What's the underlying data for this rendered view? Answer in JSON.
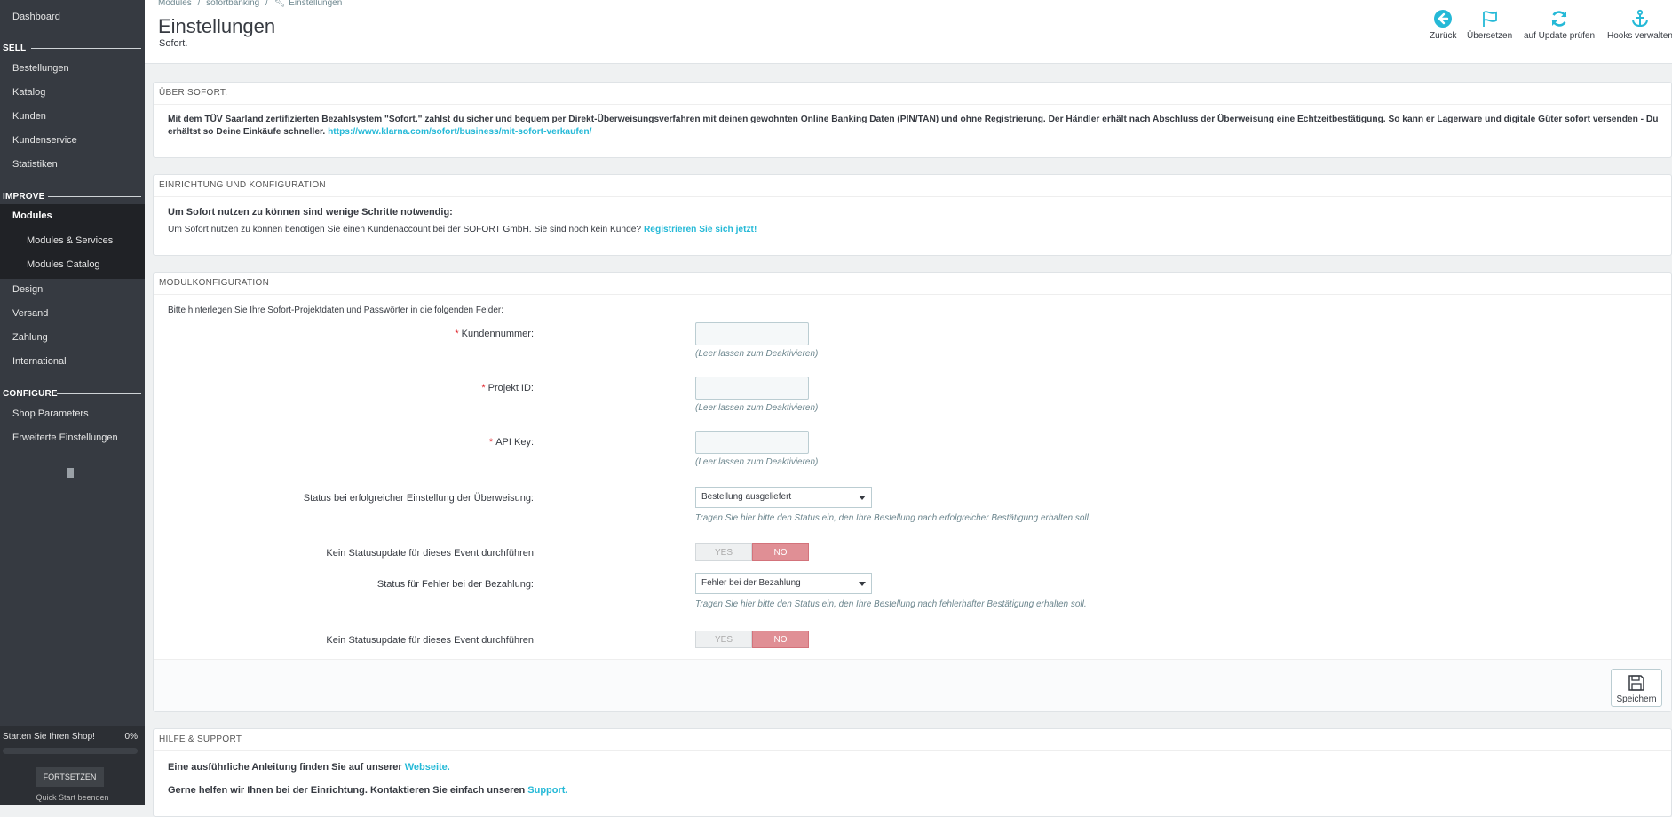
{
  "sidebar": {
    "dashboard": "Dashboard",
    "sections": {
      "sell": "SELL",
      "improve": "IMPROVE",
      "configure": "CONFIGURE"
    },
    "sell_items": [
      "Bestellungen",
      "Katalog",
      "Kunden",
      "Kundenservice",
      "Statistiken"
    ],
    "improve_items": {
      "modules": "Modules",
      "modules_services": "Modules & Services",
      "modules_catalog": "Modules Catalog",
      "design": "Design",
      "versand": "Versand",
      "zahlung": "Zahlung",
      "international": "International"
    },
    "configure_items": [
      "Shop Parameters",
      "Erweiterte Einstellungen"
    ],
    "shop_start": {
      "label": "Starten Sie Ihren Shop!",
      "percent": "0%",
      "progress": 0,
      "button": "FORTSETZEN",
      "quick_start": "Quick Start beenden"
    }
  },
  "header": {
    "breadcrumb": [
      "Modules",
      "/",
      "sofortbanking",
      "/",
      "Einstellungen"
    ],
    "title": "Einstellungen",
    "subtitle": "Sofort.",
    "toolbar": {
      "back": "Zurück",
      "translate": "Übersetzen",
      "update": "auf Update prüfen",
      "hooks": "Hooks verwalten"
    }
  },
  "about": {
    "heading": "ÜBER SOFORT.",
    "text_line1": "Mit dem TÜV Saarland zertifizierten Bezahlsystem \"Sofort.\" zahlst du sicher und bequem per Direkt-Überweisungsverfahren mit deinen gewohnten Online Banking Daten (PIN/TAN) und ohne Registrierung. Der Händler erhält nach Abschluss der Überweisung eine Echtzeitbestätigung. So kann er Lagerware und digitale Güter sofort versenden - Du",
    "text_line2": "erhältst so Deine Einkäufe schneller.",
    "link": "https://www.klarna.com/sofort/business/mit-sofort-verkaufen/"
  },
  "setup": {
    "heading": "EINRICHTUNG UND KONFIGURATION",
    "intro": "Um Sofort nutzen zu können sind wenige Schritte notwendig:",
    "text": "Um Sofort nutzen zu können benötigen Sie einen Kundenaccount bei der SOFORT GmbH. Sie sind noch kein Kunde?",
    "link": "Registrieren Sie sich jetzt!"
  },
  "config": {
    "heading": "MODULKONFIGURATION",
    "intro": "Bitte hinterlegen Sie Ihre Sofort-Projektdaten und Passwörter in die folgenden Felder:",
    "required_mark": "*",
    "customer_number_label": "Kundennummer:",
    "customer_number_value": "",
    "customer_number_help": "(Leer lassen zum Deaktivieren)",
    "project_id_label": "Projekt ID:",
    "project_id_value": "",
    "project_id_help": "(Leer lassen zum Deaktivieren)",
    "api_key_label": "API Key:",
    "api_key_value": "",
    "api_key_help": "(Leer lassen zum Deaktivieren)",
    "success_status_label": "Status bei erfolgreicher Einstellung der Überweisung:",
    "success_status_value": "Bestellung ausgeliefert",
    "success_status_help": "Tragen Sie hier bitte den Status ein, den Ihre Bestellung nach erfolgreicher Bestätigung erhalten soll.",
    "no_update_label_1": "Kein Statusupdate für dieses Event durchführen",
    "error_status_label": "Status für Fehler bei der Bezahlung:",
    "error_status_value": "Fehler bei der Bezahlung",
    "error_status_help": "Tragen Sie hier bitte den Status ein, den Ihre Bestellung nach fehlerhafter Bestätigung erhalten soll.",
    "no_update_label_2": "Kein Statusupdate für dieses Event durchführen",
    "switch_yes": "YES",
    "switch_no": "NO",
    "save": "Speichern"
  },
  "help": {
    "heading": "HILFE & SUPPORT",
    "line1": "Eine ausführliche Anleitung finden Sie auf unserer",
    "line1_link": "Webseite.",
    "line2": "Gerne helfen wir Ihnen bei der Einrichtung. Kontaktieren Sie einfach unseren",
    "line2_link": "Support."
  },
  "colors": {
    "accent": "#25b9d7",
    "sidebar": "#363a41",
    "danger_switch": "#e08f95"
  }
}
